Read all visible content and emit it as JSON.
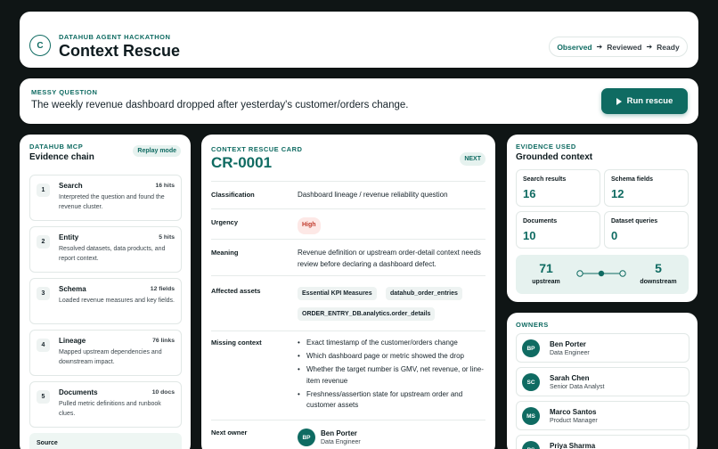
{
  "header": {
    "logo_letter": "C",
    "kicker": "DATAHUB AGENT HACKATHON",
    "title": "Context Rescue",
    "stages": [
      "Observed",
      "Reviewed",
      "Ready"
    ]
  },
  "question": {
    "kicker": "MESSY QUESTION",
    "text": "The weekly revenue dashboard dropped after yesterday's customer/orders change.",
    "run_label": "Run rescue"
  },
  "chain": {
    "kicker": "DATAHUB MCP",
    "title": "Evidence chain",
    "mode": "Replay mode",
    "steps": [
      {
        "num": "1",
        "name": "Search",
        "count": "16 hits",
        "desc": "Interpreted the question and found the revenue cluster."
      },
      {
        "num": "2",
        "name": "Entity",
        "count": "5 hits",
        "desc": "Resolved datasets, data products, and report context."
      },
      {
        "num": "3",
        "name": "Schema",
        "count": "12 fields",
        "desc": "Loaded revenue measures and key fields."
      },
      {
        "num": "4",
        "name": "Lineage",
        "count": "76 links",
        "desc": "Mapped upstream dependencies and downstream impact."
      },
      {
        "num": "5",
        "name": "Documents",
        "count": "10 docs",
        "desc": "Pulled metric definitions and runbook clues."
      }
    ],
    "source_label": "Source"
  },
  "card": {
    "kicker": "CONTEXT RESCUE CARD",
    "id": "CR-0001",
    "badge": "NEXT",
    "classification_label": "Classification",
    "classification": "Dashboard lineage / revenue reliability question",
    "urgency_label": "Urgency",
    "urgency": "High",
    "meaning_label": "Meaning",
    "meaning": "Revenue definition or upstream order-detail context needs review before declaring a dashboard defect.",
    "assets_label": "Affected assets",
    "assets": [
      "Essential KPI Measures",
      "datahub_order_entries",
      "ORDER_ENTRY_DB.analytics.order_details"
    ],
    "missing_label": "Missing context",
    "missing": [
      "Exact timestamp of the customer/orders change",
      "Which dashboard page or metric showed the drop",
      "Whether the target number is GMV, net revenue, or line-item revenue",
      "Freshness/assertion state for upstream order and customer assets"
    ],
    "next_owner_label": "Next owner",
    "next_owner": {
      "initials": "BP",
      "name": "Ben Porter",
      "role": "Data Engineer"
    }
  },
  "evidence": {
    "kicker": "EVIDENCE USED",
    "title": "Grounded context",
    "stats": [
      {
        "label": "Search results",
        "value": "16"
      },
      {
        "label": "Schema fields",
        "value": "12"
      },
      {
        "label": "Documents",
        "value": "10"
      },
      {
        "label": "Dataset queries",
        "value": "0"
      }
    ],
    "upstream_value": "71",
    "upstream_label": "upstream",
    "downstream_value": "5",
    "downstream_label": "downstream"
  },
  "owners": {
    "kicker": "OWNERS",
    "list": [
      {
        "initials": "BP",
        "name": "Ben Porter",
        "role": "Data Engineer"
      },
      {
        "initials": "SC",
        "name": "Sarah Chen",
        "role": "Senior Data Analyst"
      },
      {
        "initials": "MS",
        "name": "Marco Santos",
        "role": "Product Manager"
      },
      {
        "initials": "PS",
        "name": "Priya Sharma",
        "role": ""
      }
    ]
  },
  "colors": {
    "accent": "#0f6b62",
    "accent_soft": "#e6f2ef",
    "background": "#0f1515",
    "danger": "#c0392b"
  }
}
